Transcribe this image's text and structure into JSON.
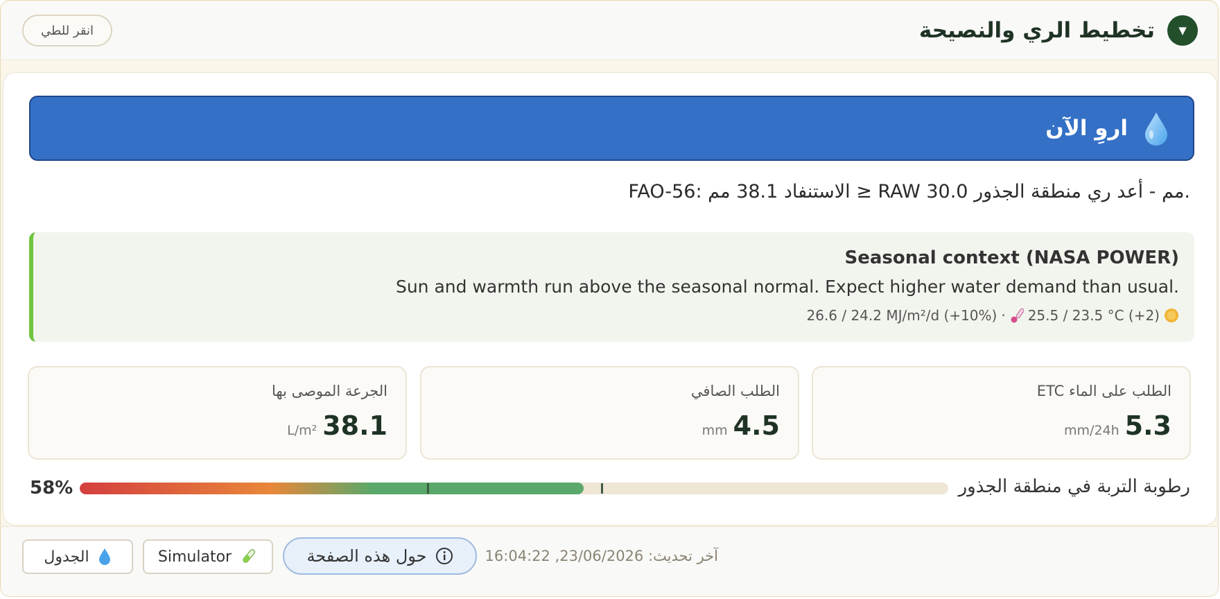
{
  "header": {
    "title": "تخطيط الري والنصيحة",
    "collapse_label": "انقر للطي",
    "toggle_glyph": "▼"
  },
  "banner": {
    "text": "اروِ الآن",
    "color": "#3470c6",
    "icon": "water-drop-icon"
  },
  "fao_text": "FAO-56: الاستنفاد 38.1 مم ≥ RAW 30.0 مم - أعد ري منطقة الجذور.",
  "seasonal": {
    "title": "Seasonal context (NASA POWER)",
    "description": "Sun and warmth run above the seasonal normal. Expect higher water demand than usual.",
    "solar": "26.6 / 24.2 MJ/m²/d (+10%)",
    "separator": "·",
    "temperature": "25.5 / 23.5 °C (+2)",
    "accent_color": "#6fc440"
  },
  "metrics": [
    {
      "label": "الطلب على الماء ETC",
      "value": "5.3",
      "unit": "mm/24h"
    },
    {
      "label": "الطلب الصافي",
      "value": "4.5",
      "unit": "mm"
    },
    {
      "label": "الجرعة الموصى بها",
      "value": "38.1",
      "unit": "L/m²"
    }
  ],
  "soil_moisture": {
    "label": "رطوبة التربة في منطقة الجذور",
    "percent_text": "58%",
    "fill_fraction": 0.58,
    "marker_fractions": [
      0.4,
      0.6
    ]
  },
  "footer": {
    "updated": "آخر تحديث: 23/06/2026, 16:04:22",
    "about_label": "حول هذه الصفحة",
    "simulator_label": "Simulator",
    "schedule_label": "الجدول"
  }
}
